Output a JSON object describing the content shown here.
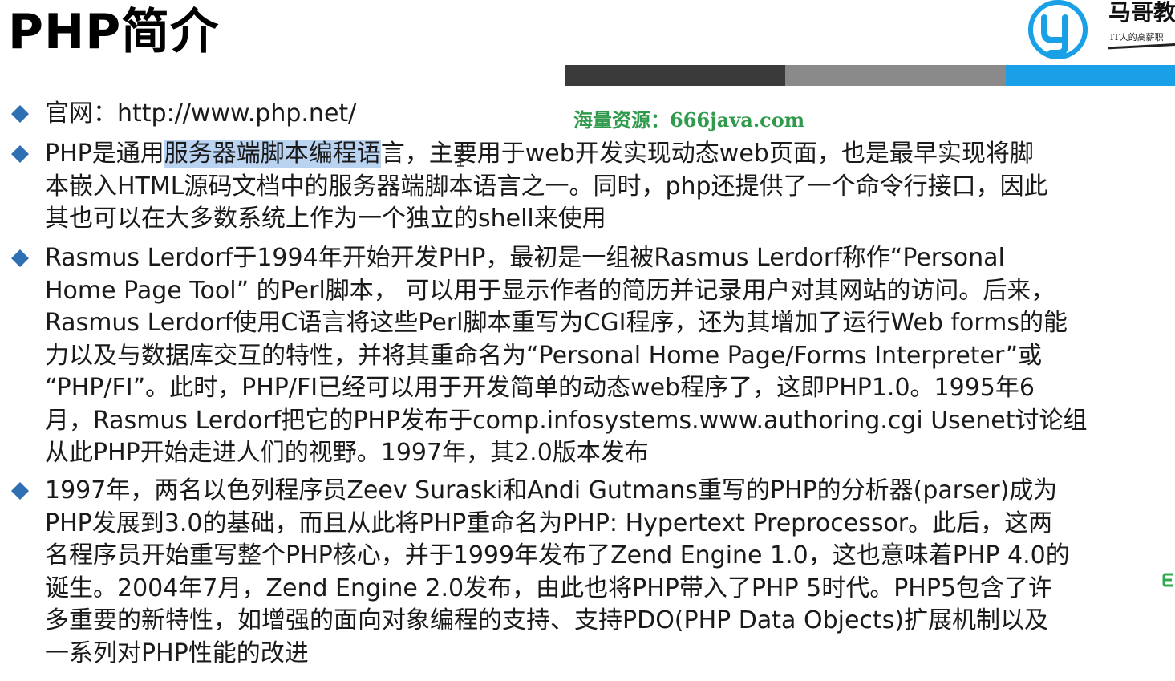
{
  "slide": {
    "title": "PHP简介",
    "watermark": "海量资源：666java.com"
  },
  "logo": {
    "name": "马哥教",
    "slogan": "IT人的高薪职",
    "colors": {
      "ring": "#1aa0e6",
      "glyph": "#1aa0e6"
    }
  },
  "header_bar": {
    "colors": [
      "#3a3a3a",
      "#8a8a8a",
      "#1aa0e6"
    ]
  },
  "bullets": [
    {
      "lines": [
        {
          "segments": [
            {
              "text": "官网：http://www.php.net/",
              "highlight": false
            }
          ]
        }
      ]
    },
    {
      "lines": [
        {
          "segments": [
            {
              "text": "PHP是通用",
              "highlight": false
            },
            {
              "text": "服务器端脚本编程语",
              "highlight": true
            },
            {
              "text": "言，主要用于web开发实现动态web页面，也是最早实现将脚",
              "highlight": false
            }
          ]
        },
        {
          "segments": [
            {
              "text": "本嵌入HTML源码文档中的服务器端脚本语言之一。同时，php还提供了一个命令行接口，因此",
              "highlight": false
            }
          ]
        },
        {
          "segments": [
            {
              "text": "其也可以在大多数系统上作为一个独立的shell来使用",
              "highlight": false
            }
          ]
        }
      ]
    },
    {
      "lines": [
        {
          "segments": [
            {
              "text": "Rasmus Lerdorf于1994年开始开发PHP，最初是一组被Rasmus Lerdorf称作“Personal",
              "highlight": false
            }
          ]
        },
        {
          "segments": [
            {
              "text": "Home Page Tool” 的Perl脚本， 可以用于显示作者的简历并记录用户对其网站的访问。后来，",
              "highlight": false
            }
          ]
        },
        {
          "segments": [
            {
              "text": "Rasmus Lerdorf使用C语言将这些Perl脚本重写为CGI程序，还为其增加了运行Web forms的能",
              "highlight": false
            }
          ]
        },
        {
          "segments": [
            {
              "text": "力以及与数据库交互的特性，并将其重命名为“Personal Home Page/Forms Interpreter”或",
              "highlight": false
            }
          ]
        },
        {
          "segments": [
            {
              "text": "“PHP/FI”。此时，PHP/FI已经可以用于开发简单的动态web程序了，这即PHP1.0。1995年6",
              "highlight": false
            }
          ]
        },
        {
          "segments": [
            {
              "text": "月，Rasmus Lerdorf把它的PHP发布于comp.infosystems.www.authoring.cgi Usenet讨论组",
              "highlight": false
            }
          ]
        },
        {
          "segments": [
            {
              "text": "从此PHP开始走进人们的视野。1997年，其2.0版本发布",
              "highlight": false
            }
          ]
        }
      ]
    },
    {
      "lines": [
        {
          "segments": [
            {
              "text": "1997年，两名以色列程序员Zeev Suraski和Andi Gutmans重写的PHP的分析器(parser)成为",
              "highlight": false
            }
          ]
        },
        {
          "segments": [
            {
              "text": "PHP发展到3.0的基础，而且从此将PHP重命名为PHP: Hypertext Preprocessor。此后，这两",
              "highlight": false
            }
          ]
        },
        {
          "segments": [
            {
              "text": "名程序员开始重写整个PHP核心，并于1999年发布了Zend Engine 1.0，这也意味着PHP 4.0的",
              "highlight": false
            }
          ]
        },
        {
          "segments": [
            {
              "text": "诞生。2004年7月，Zend Engine 2.0发布，由此也将PHP带入了PHP 5时代。PHP5包含了许",
              "highlight": false
            }
          ]
        },
        {
          "segments": [
            {
              "text": "多重要的新特性，如增强的面向对象编程的支持、支持PDO(PHP Data Objects)扩展机制以及",
              "highlight": false
            }
          ]
        },
        {
          "segments": [
            {
              "text": "一系列对PHP性能的改进",
              "highlight": false
            }
          ]
        }
      ]
    }
  ],
  "colors": {
    "bullet": "#2f6fb4",
    "highlight": "#b9d3f1",
    "watermark": "#2f9a4b"
  }
}
